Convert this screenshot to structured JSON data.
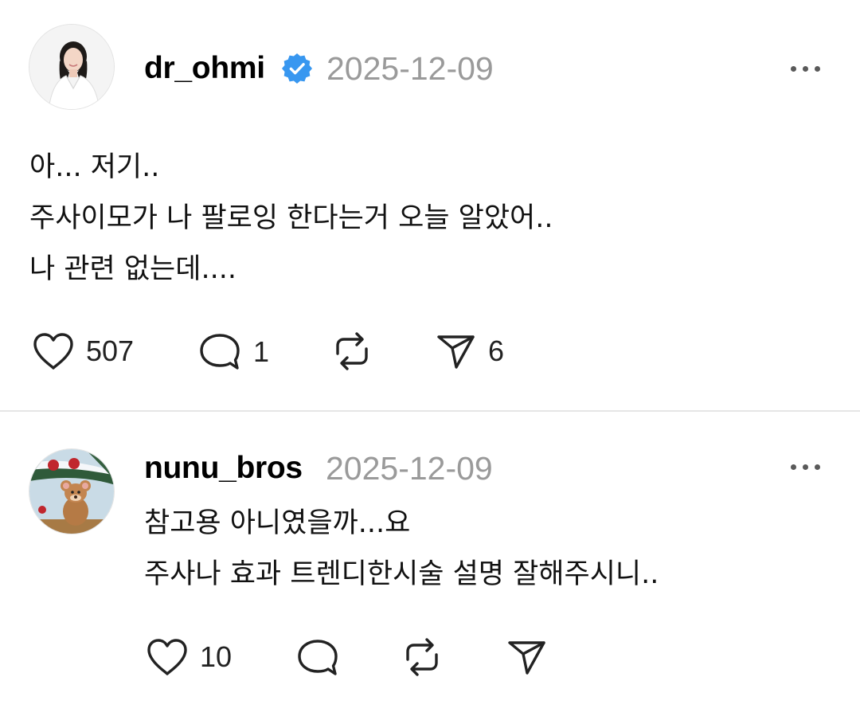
{
  "posts": [
    {
      "username": "dr_ohmi",
      "verified": true,
      "date": "2025-12-09",
      "lines": [
        "아... 저기..",
        "주사이모가 나 팔로잉 한다는거 오늘 알았어..",
        "나 관련 없는데...."
      ],
      "likes": "507",
      "replies": "1",
      "shares": "6"
    },
    {
      "username": "nunu_bros",
      "verified": false,
      "date": "2025-12-09",
      "lines": [
        "참고용 아니였을까...요",
        "주사나 효과 트렌디한시술 설명 잘해주시니.."
      ],
      "likes": "10"
    }
  ],
  "colors": {
    "verified_badge": "#3897f0",
    "date_text": "#9a9a9a",
    "divider": "#e6e6e6"
  },
  "icons": [
    "heart-icon",
    "reply-icon",
    "repost-icon",
    "share-icon",
    "more-icon",
    "verified-badge-icon"
  ]
}
